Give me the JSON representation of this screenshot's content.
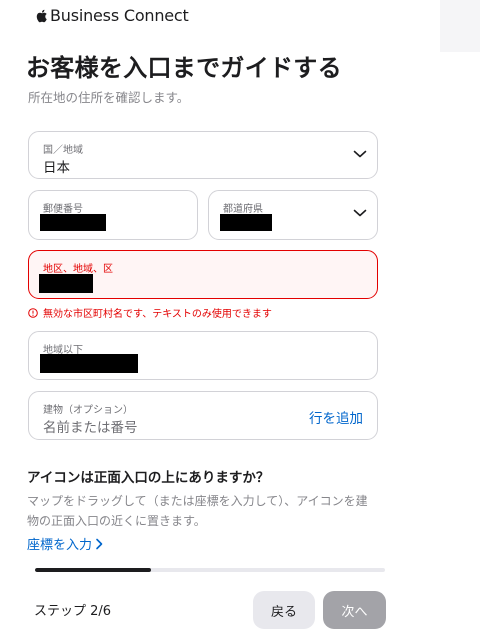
{
  "header": {
    "brand": "Business Connect",
    "logo_icon": "apple-logo-icon"
  },
  "page": {
    "title": "お客様を入口までガイドする",
    "subtitle": "所在地の住所を確認します。"
  },
  "form": {
    "country": {
      "label": "国／地域",
      "value": "日本"
    },
    "postal_code": {
      "label": "郵便番号"
    },
    "prefecture": {
      "label": "都道府県"
    },
    "district": {
      "label": "地区、地域、区"
    },
    "district_error": "無効な市区町村名です、テキストのみ使用できます",
    "street": {
      "label": "地域以下"
    },
    "building": {
      "label": "建物（オプション）",
      "placeholder": "名前または番号",
      "add_line": "行を追加"
    }
  },
  "entrance": {
    "question": "アイコンは正面入口の上にありますか？",
    "description": "マップをドラッグして（または座標を入力して）、アイコンを建物の正面入口の近くに置きます。",
    "coord_link": "座標を入力"
  },
  "footer": {
    "progress": 0.33,
    "step_label": "ステップ 2/6",
    "back_label": "戻る",
    "next_label": "次へ"
  },
  "colors": {
    "error": "#e30000",
    "link": "#0066cc",
    "disabled_button": "#a3a3a8"
  }
}
